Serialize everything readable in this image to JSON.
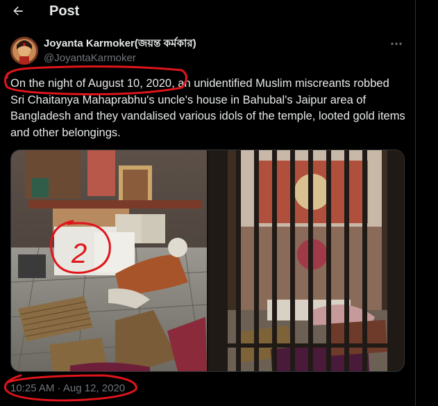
{
  "header": {
    "title": "Post",
    "back_icon": "arrow-left-icon"
  },
  "author": {
    "name": "Joyanta Karmoker(জয়ন্ত কর্মকার)",
    "handle": "@JoyantaKarmoker"
  },
  "tweet": {
    "text": "On the night of August 10, 2020, an unidentified Muslim miscreants robbed  Sri Chaitanya Mahaprabhu's uncle's house in Bahubal's Jaipur area of Bangladesh and they vandalised various idols of the temple, looted gold items and other belongings."
  },
  "media": {
    "photos": [
      {
        "description": "vandalised temple interior with fallen idols and mats"
      },
      {
        "description": "temple interior behind iron gate bars"
      }
    ]
  },
  "timestamp": "10:25 AM · Aug 12, 2020",
  "annotations": {
    "number": "2",
    "color": "#e0151b"
  },
  "colors": {
    "background": "#000000",
    "text": "#e7e9ea",
    "muted": "#71767b",
    "border": "#2f3336"
  }
}
